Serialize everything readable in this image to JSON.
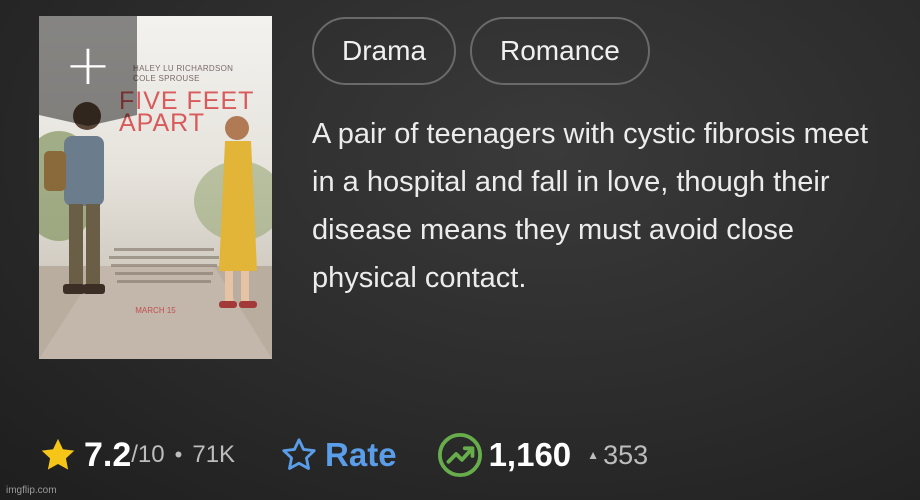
{
  "poster": {
    "title": "FIVE FEET APART",
    "cast": [
      "HALEY LU RICHARDSON",
      "COLE SPROUSE"
    ],
    "release": "MARCH 15",
    "add_label": "+"
  },
  "genres": [
    "Drama",
    "Romance"
  ],
  "description": "A pair of teenagers with cystic fibrosis meet in a hospital and fall in love, though their disease means they must avoid close physical contact.",
  "rating": {
    "value": "7.2",
    "max": "/10",
    "separator": "•",
    "votes": "71K"
  },
  "rate": {
    "label": "Rate"
  },
  "popularity": {
    "value": "1,160",
    "change_icon": "▲",
    "change": "353"
  },
  "watermark": "imgflip.com",
  "colors": {
    "star": "#f5c518",
    "rate_blue": "#5a9de8",
    "trend_green": "#67ad4b"
  }
}
